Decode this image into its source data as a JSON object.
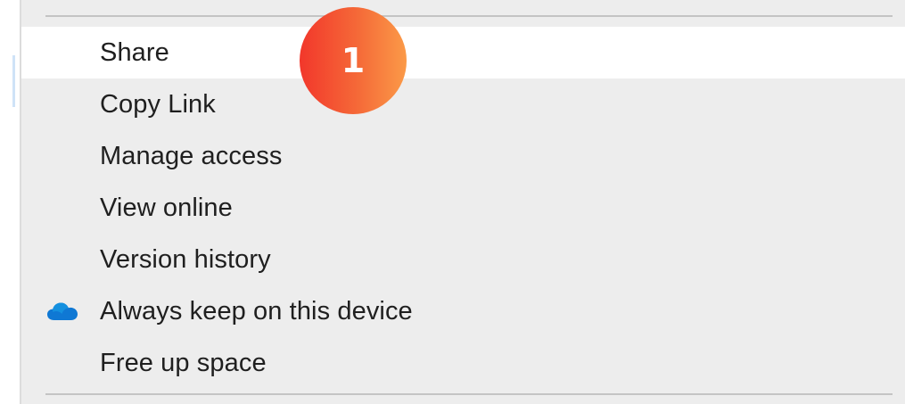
{
  "context_menu": {
    "items": [
      {
        "label": "Share",
        "icon": "",
        "highlighted": true
      },
      {
        "label": "Copy Link",
        "icon": ""
      },
      {
        "label": "Manage access",
        "icon": ""
      },
      {
        "label": "View online",
        "icon": ""
      },
      {
        "label": "Version history",
        "icon": ""
      },
      {
        "label": "Always keep on this device",
        "icon": "onedrive-cloud-icon"
      },
      {
        "label": "Free up space",
        "icon": ""
      }
    ]
  },
  "annotation": {
    "step_number": "1",
    "colors": [
      "#f2372b",
      "#fb9a48"
    ]
  },
  "colors": {
    "menu_background": "#ededed",
    "highlight_background": "#ffffff",
    "onedrive_blue": "#0f78d4",
    "separator": "#c4c4c4"
  }
}
